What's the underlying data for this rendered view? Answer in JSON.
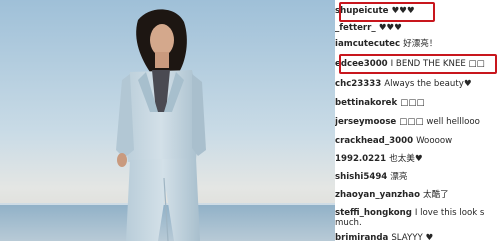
{
  "accent_highlight": "#c8161d",
  "comments": [
    {
      "user": "shupeicute",
      "text": "♥♥♥"
    },
    {
      "user": "_fetterr_",
      "text": "♥♥♥"
    },
    {
      "user": "iamcutecutec",
      "text": "好漂亮！"
    },
    {
      "user": "edcee3000",
      "text": "I BEND THE KNEE □□"
    },
    {
      "user": "chc23333",
      "text": "Always the beauty♥"
    },
    {
      "user": "bettinakorek",
      "text": "□□□"
    },
    {
      "user": "jerseymoose",
      "text": "□□□ well helllooo"
    },
    {
      "user": "crackhead_3000",
      "text": "Woooow"
    },
    {
      "user": "1992.0221",
      "text": "也太美♥"
    },
    {
      "user": "shishi5494",
      "text": "漂亮"
    },
    {
      "user": "zhaoyan_yanzhao",
      "text": "太酷了"
    },
    {
      "user": "steffi_hongkong",
      "text": "I love this look s"
    },
    {
      "user": "",
      "text": "much."
    },
    {
      "user": "brimiranda",
      "text": "SLAYYY ♥"
    }
  ]
}
